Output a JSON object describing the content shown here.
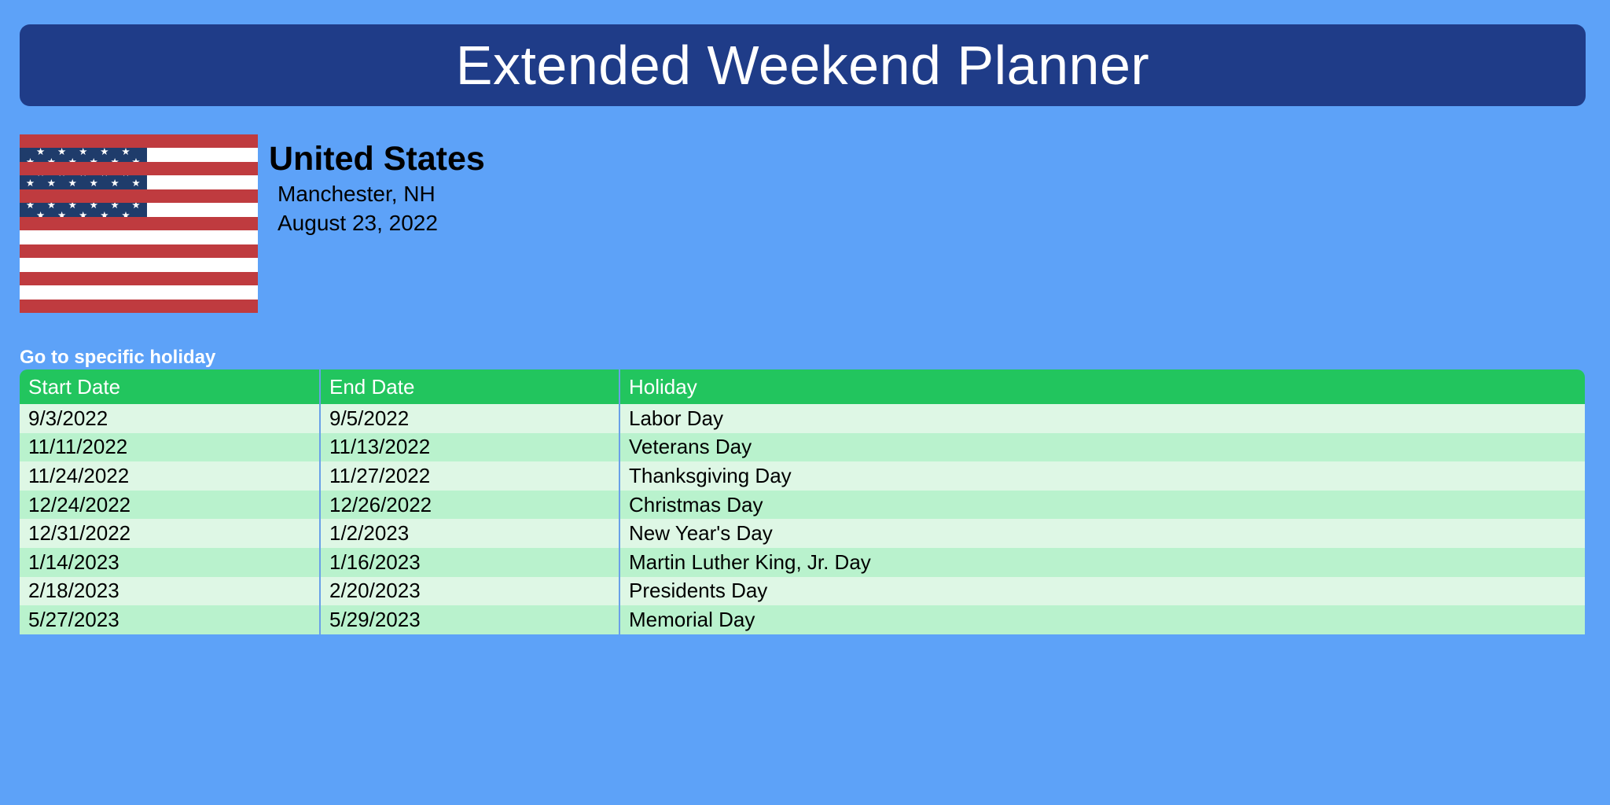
{
  "header": {
    "title": "Extended Weekend Planner",
    "bar_color": "#1f3c88"
  },
  "page": {
    "background_color": "#5da2f8"
  },
  "country": {
    "flag_icon": "us-flag-icon",
    "name": "United States",
    "city": "Manchester, NH",
    "date": "August 23, 2022",
    "flag_colors": {
      "canton": "#1f3c6b",
      "stripe_red": "#bf3b3f",
      "stripe_white": "#ffffff"
    }
  },
  "jump": {
    "label": "Go to specific holiday"
  },
  "table": {
    "header_color": "#22c55e",
    "row_color_odd": "#def7e5",
    "row_color_even": "#b9f2cd",
    "columns": [
      "Start Date",
      "End Date",
      "Holiday"
    ],
    "rows": [
      {
        "start": "9/3/2022",
        "end": "9/5/2022",
        "holiday": "Labor Day"
      },
      {
        "start": "11/11/2022",
        "end": "11/13/2022",
        "holiday": "Veterans Day"
      },
      {
        "start": "11/24/2022",
        "end": "11/27/2022",
        "holiday": "Thanksgiving Day"
      },
      {
        "start": "12/24/2022",
        "end": "12/26/2022",
        "holiday": "Christmas Day"
      },
      {
        "start": "12/31/2022",
        "end": "1/2/2023",
        "holiday": "New Year's Day"
      },
      {
        "start": "1/14/2023",
        "end": "1/16/2023",
        "holiday": "Martin Luther King, Jr. Day"
      },
      {
        "start": "2/18/2023",
        "end": "2/20/2023",
        "holiday": "Presidents Day"
      },
      {
        "start": "5/27/2023",
        "end": "5/29/2023",
        "holiday": "Memorial Day"
      }
    ]
  }
}
